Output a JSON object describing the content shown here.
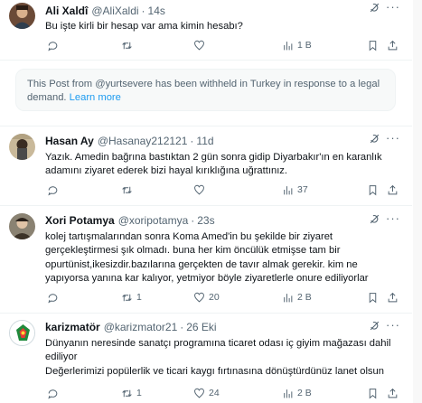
{
  "posts": [
    {
      "name": "Ali Xaldî",
      "handle": "@AliXaldi",
      "time": "14s",
      "lines": [
        "Bu işte kirli bir hesap var ama kimin hesabı?"
      ],
      "replies": "",
      "reposts": "",
      "likes": "",
      "views": "1 B"
    },
    {
      "name": "Hasan Ay",
      "handle": "@Hasanay212121",
      "time": "11d",
      "lines": [
        "Yazık. Amedin bağrına bastıktan  2 gün sonra gidip Diyarbakır'ın en karanlık",
        "adamını ziyaret ederek bizi hayal kırıklığına uğrattınız."
      ],
      "replies": "",
      "reposts": "",
      "likes": "",
      "views": "37"
    },
    {
      "name": "Xori Potamya",
      "handle": "@xoripotamya",
      "time": "23s",
      "lines": [
        "kolej tartışmalarından sonra Koma Amed'in bu şekilde bir ziyaret",
        "gerçekleştirmesi şık olmadı. buna her kim öncülük etmişse tam bir",
        "opurtünist,ikesizdir.bazılarına gerçekten de tavır almak gerekir. kim ne",
        "yapıyorsa yanına kar kalıyor, yetmiyor böyle ziyaretlerle onure ediliyorlar"
      ],
      "replies": "",
      "reposts": "1",
      "likes": "20",
      "views": "2 B"
    },
    {
      "name": "karizmatör",
      "handle": "@karizmator21",
      "time": "26 Eki",
      "lines": [
        "Dünyanın neresinde sanatçı programına ticaret odası iç giyim mağazası dahil",
        "ediliyor",
        "Değerlerimizi popülerlik ve ticari kaygı fırtınasına dönüştürdünüz lanet olsun"
      ],
      "replies": "",
      "reposts": "1",
      "likes": "24",
      "views": "2 B"
    }
  ],
  "withheld": {
    "text": "This Post from @yurtsevere has been withheld in Turkey in response to a legal demand.",
    "link": "Learn more"
  },
  "icons": [
    "more-icon",
    "grok-icon",
    "reply-icon",
    "repost-icon",
    "like-icon",
    "views-icon",
    "bookmark-icon",
    "share-icon"
  ],
  "colors": {
    "text": "#0f1419",
    "muted": "#536471",
    "link": "#1d9bf0",
    "divider": "#eff3f4"
  }
}
